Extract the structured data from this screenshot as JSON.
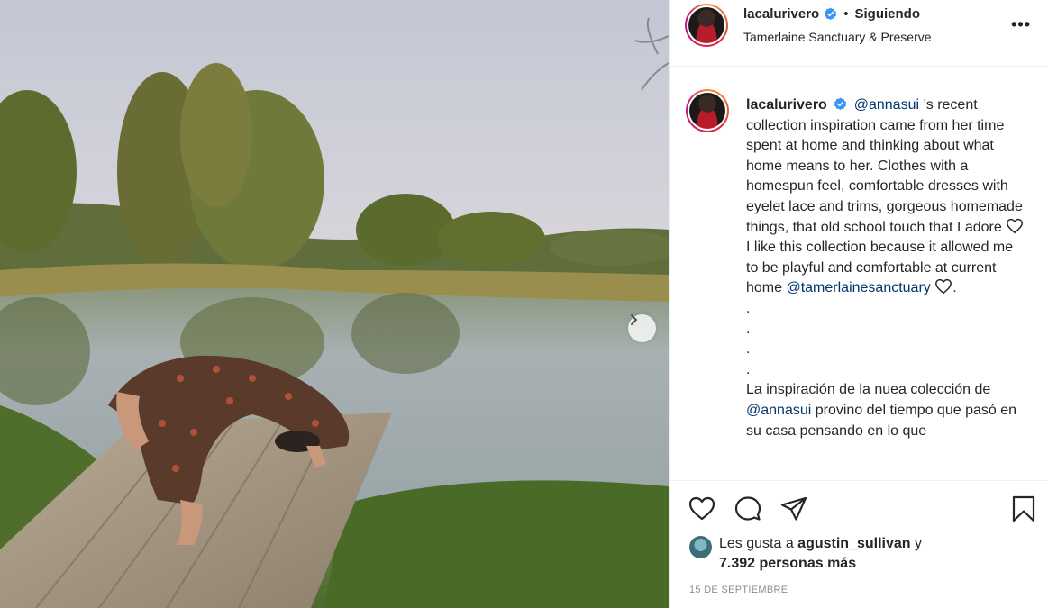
{
  "post": {
    "username": "lacalurivero",
    "separator": "•",
    "follow_status": "Siguiendo",
    "location": "Tamerlaine Sanctuary & Preserve",
    "more_label": "•••"
  },
  "caption": {
    "username": "lacalurivero",
    "mention1": "@annasui",
    "text1": " ’s recent collection inspiration came from her time spent at home and thinking about what home means to her. Clothes with a homespun feel, comfortable dresses with eyelet lace and trims, gorgeous homemade things, that old school touch that I adore ",
    "text2": " I like this collection because it allowed me to be playful and comfortable at current home ",
    "mention2": "@tamerlainesanctuary",
    "text3": ".",
    "dots": [
      ".",
      ".",
      ".",
      "."
    ],
    "spanish1": "La inspiración de la nuea colección de ",
    "mention3": "@annasui",
    "spanish2": " provino del tiempo que pasó en su casa pensando en lo que"
  },
  "likes": {
    "prefix": "Les gusta a ",
    "user": "agustin_sullivan",
    "joiner": " y",
    "count": "7.392 personas más"
  },
  "date": "15 DE SEPTIEMBRE",
  "icons": {
    "like": "heart-icon",
    "comment": "comment-icon",
    "share": "share-icon",
    "save": "bookmark-icon",
    "verified": "verified-badge-icon",
    "next": "chevron-right-icon"
  },
  "colors": {
    "text": "#262626",
    "mention": "#00376b",
    "verified": "#3897f0",
    "muted": "#8e8e8e"
  }
}
